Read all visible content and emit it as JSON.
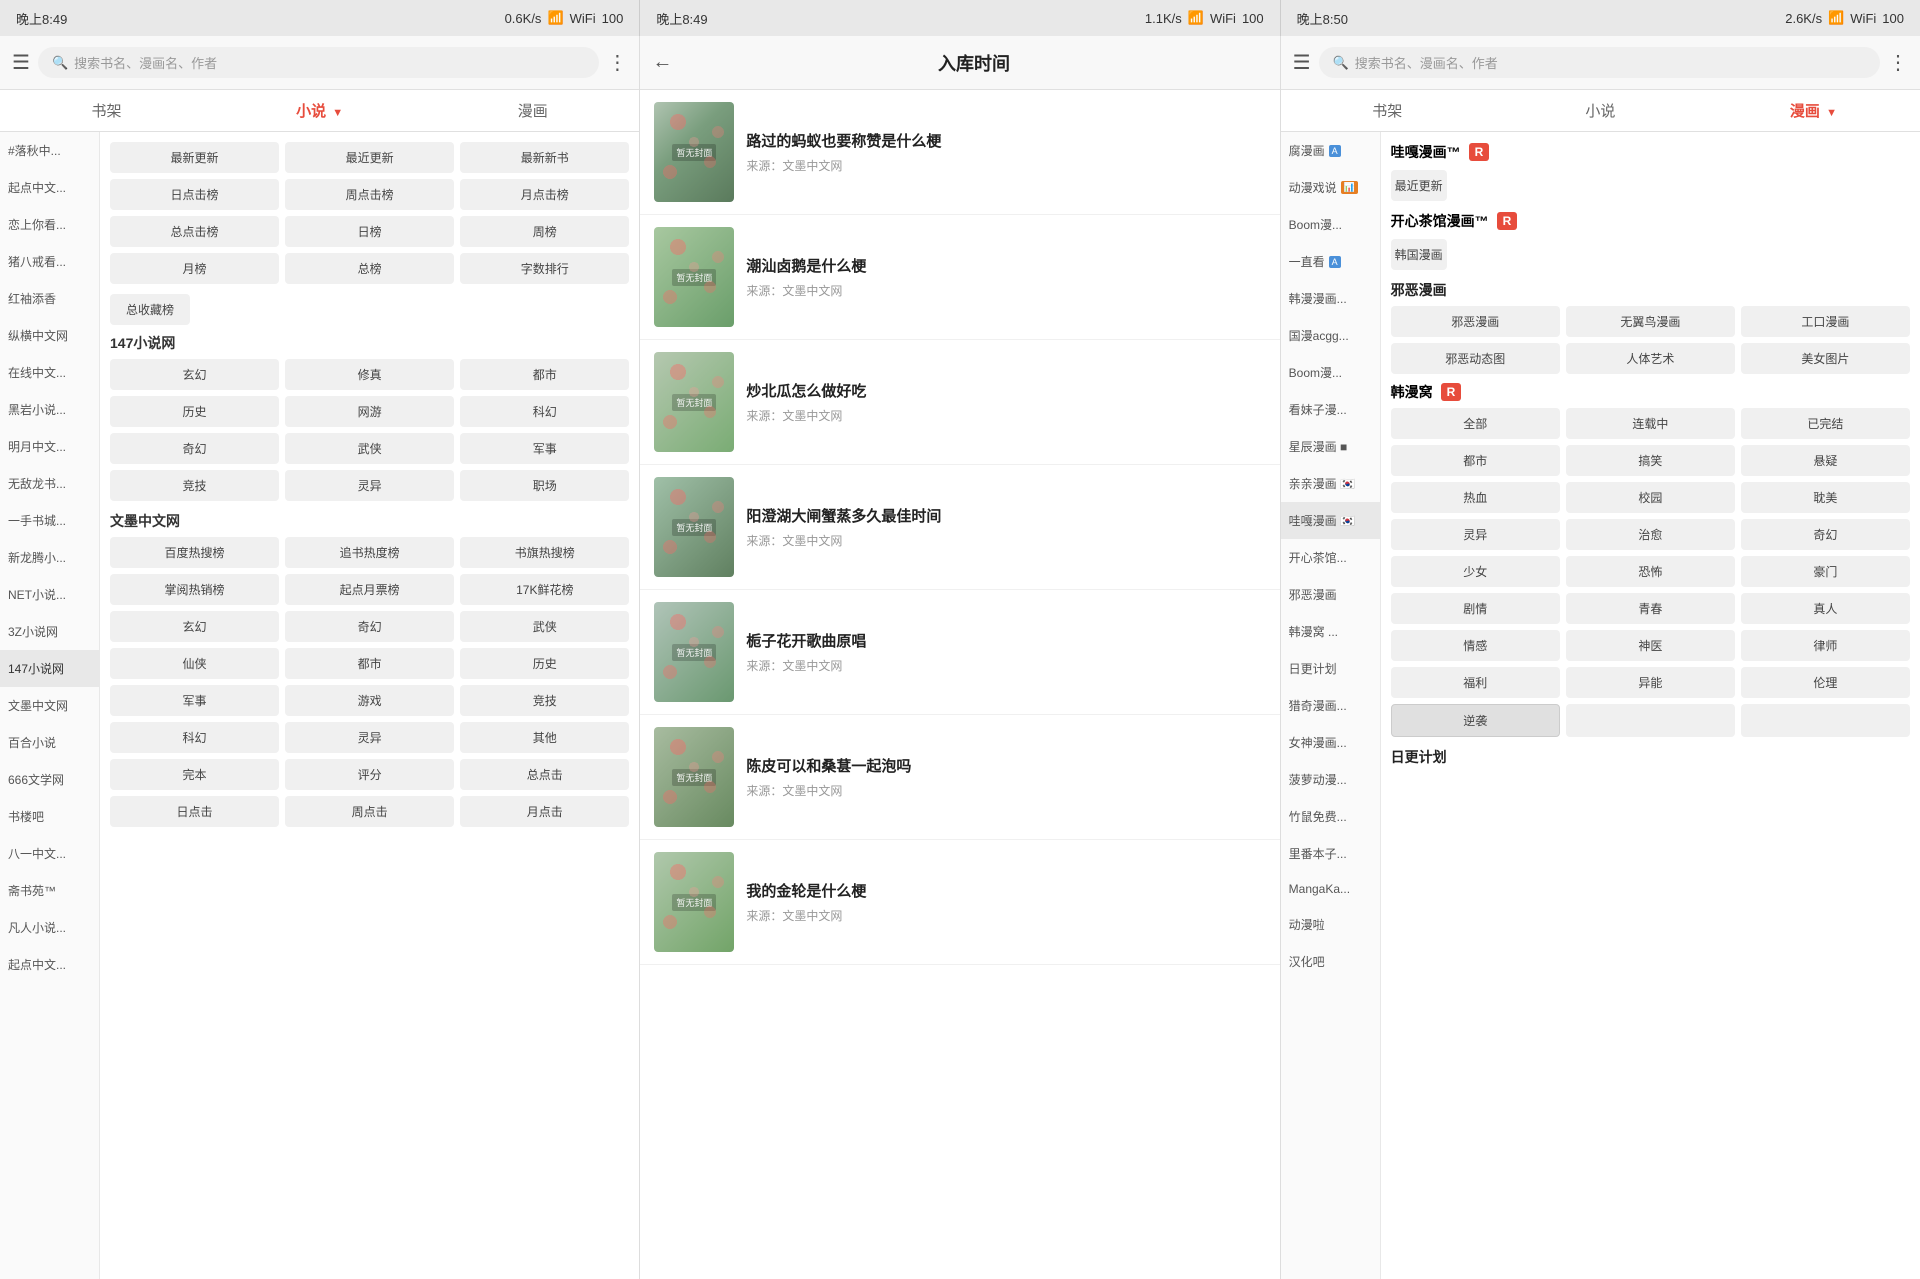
{
  "statusBars": [
    {
      "time": "晚上8:49",
      "speed": "0.6K/s",
      "battery": "100"
    },
    {
      "time": "晚上8:49",
      "speed": "1.1K/s",
      "battery": "100"
    },
    {
      "time": "晚上8:50",
      "speed": "2.6K/s",
      "battery": "100"
    }
  ],
  "panel1": {
    "searchPlaceholder": "搜索书名、漫画名、作者",
    "tabs": [
      "书架",
      "小说",
      "漫画"
    ],
    "activeTab": 1,
    "sidebarItems": [
      "#落秋中...",
      "起点中文...",
      "恋上你看...",
      "猪八戒看...",
      "红袖添香",
      "纵横中文网",
      "在线中文...",
      "黑岩小说...",
      "明月中文...",
      "无敌龙书...",
      "一手书城...",
      "新龙腾小...",
      "NET小说...",
      "3Z小说网",
      "147小说网",
      "文墨中文网",
      "百合小说",
      "666文学网",
      "书楼吧",
      "八一中文...",
      "斋书苑™",
      "凡人小说...",
      "起点中文..."
    ],
    "activeSidebarItem": "147小说网",
    "sections": [
      {
        "title": "147小说网",
        "buttons3": [
          [
            "玄幻",
            "修真",
            "都市"
          ],
          [
            "历史",
            "网游",
            "科幻"
          ],
          [
            "奇幻",
            "武侠",
            "军事"
          ],
          [
            "竞技",
            "灵异",
            "职场"
          ]
        ]
      },
      {
        "title": "文墨中文网",
        "topButtons3": [
          [
            "百度热搜榜",
            "追书热度榜",
            "书旗热搜榜"
          ],
          [
            "掌阅热销榜",
            "起点月票榜",
            "17K鲜花榜"
          ]
        ],
        "genreButtons3": [
          [
            "玄幻",
            "奇幻",
            "武侠"
          ],
          [
            "仙侠",
            "都市",
            "历史"
          ],
          [
            "军事",
            "游戏",
            "竞技"
          ],
          [
            "科幻",
            "灵异",
            "其他"
          ],
          [
            "完本",
            "评分",
            "总点击"
          ],
          [
            "日点击",
            "周点击",
            "月点击"
          ]
        ]
      }
    ],
    "topButtons": [
      [
        "最新更新",
        "最近更新",
        "最新新书"
      ],
      [
        "日点击榜",
        "周点击榜",
        "月点击榜"
      ],
      [
        "总点击榜",
        "日榜",
        "周榜"
      ],
      [
        "月榜",
        "总榜",
        "字数排行"
      ]
    ],
    "totalFavBtn": "总收藏榜"
  },
  "panel2": {
    "title": "入库时间",
    "books": [
      {
        "title": "路过的蚂蚁也要称赞是什么梗",
        "source": "来源：文墨中文网"
      },
      {
        "title": "潮汕卤鹅是什么梗",
        "source": "来源：文墨中文网"
      },
      {
        "title": "炒北瓜怎么做好吃",
        "source": "来源：文墨中文网"
      },
      {
        "title": "阳澄湖大闸蟹蒸多久最佳时间",
        "source": "来源：文墨中文网"
      },
      {
        "title": "栀子花开歌曲原唱",
        "source": "来源：文墨中文网"
      },
      {
        "title": "陈皮可以和桑葚一起泡吗",
        "source": "来源：文墨中文网"
      },
      {
        "title": "我的金轮是什么梗",
        "source": "来源：文墨中文网"
      }
    ],
    "noCoverText": "暂无封面"
  },
  "panel3": {
    "searchPlaceholder": "搜索书名、漫画名、作者",
    "tabs": [
      "书架",
      "小说",
      "漫画"
    ],
    "activeTab": 2,
    "sidebarItems": [
      {
        "name": "腐漫画",
        "badge": "A",
        "badgeType": "blue"
      },
      {
        "name": "动漫戏说",
        "badge": "📊",
        "badgeType": "orange"
      },
      {
        "name": "Boom漫...",
        "badge": "",
        "badgeType": ""
      },
      {
        "name": "一直看",
        "badge": "A",
        "badgeType": "blue"
      },
      {
        "name": "韩漫漫画...",
        "badge": "",
        "badgeType": ""
      },
      {
        "name": "国漫acgg...",
        "badge": "",
        "badgeType": ""
      },
      {
        "name": "Boom漫...",
        "badge": "",
        "badgeType": ""
      },
      {
        "name": "看妹子漫...",
        "badge": "",
        "badgeType": ""
      },
      {
        "name": "星辰漫画",
        "badge": "■",
        "badgeType": ""
      },
      {
        "name": "亲亲漫画",
        "badge": "🇰🇷",
        "badgeType": ""
      },
      {
        "name": "哇嘎漫画",
        "badge": "🇰🇷",
        "badgeType": "active"
      },
      {
        "name": "开心茶馆...",
        "badge": "",
        "badgeType": ""
      },
      {
        "name": "邪恶漫画",
        "badge": "",
        "badgeType": ""
      },
      {
        "name": "韩漫窝",
        "badge": "...",
        "badgeType": ""
      },
      {
        "name": "日更计划",
        "badge": "",
        "badgeType": ""
      },
      {
        "name": "猎奇漫画...",
        "badge": "",
        "badgeType": ""
      },
      {
        "name": "女神漫画...",
        "badge": "",
        "badgeType": ""
      },
      {
        "name": "菠萝动漫...",
        "badge": "",
        "badgeType": ""
      },
      {
        "name": "竹鼠免费...",
        "badge": "",
        "badgeType": ""
      },
      {
        "name": "里番本子...",
        "badge": "",
        "badgeType": ""
      },
      {
        "name": "MangaKa...",
        "badge": "",
        "badgeType": ""
      },
      {
        "name": "动漫啦",
        "badge": "",
        "badgeType": ""
      },
      {
        "name": "汉化吧",
        "badge": "",
        "badgeType": ""
      }
    ],
    "activeSidebarItem": "哇嘎漫画",
    "sections": [
      {
        "type": "header_with_btn",
        "sourceName": "哇嘎漫画™",
        "rBadge": "R",
        "btn": "最近更新"
      },
      {
        "type": "link_section",
        "title": "开心茶馆漫画™",
        "rBadge": "R",
        "btn": "韩国漫画"
      },
      {
        "type": "tag_section",
        "title": "邪恶漫画",
        "tags3": [
          [
            "邪恶漫画",
            "无翼鸟漫画",
            "工口漫画"
          ],
          [
            "邪恶动态图",
            "人体艺术",
            "美女图片"
          ]
        ]
      },
      {
        "type": "hanman_section",
        "title": "韩漫窝",
        "rBadge": "R",
        "filterTags": [
          "全部",
          "连载中",
          "已完结"
        ],
        "categoryTags3": [
          [
            "都市",
            "搞笑",
            "悬疑"
          ],
          [
            "热血",
            "校园",
            "耽美"
          ],
          [
            "灵异",
            "治愈",
            "奇幻"
          ],
          [
            "少女",
            "恐怖",
            "豪门"
          ],
          [
            "剧情",
            "青春",
            "真人"
          ],
          [
            "情感",
            "神医",
            "律师"
          ],
          [
            "福利",
            "异能",
            "伦理"
          ],
          [
            "逆袭",
            "",
            ""
          ]
        ]
      },
      {
        "type": "plain_title",
        "title": "日更计划"
      }
    ]
  }
}
